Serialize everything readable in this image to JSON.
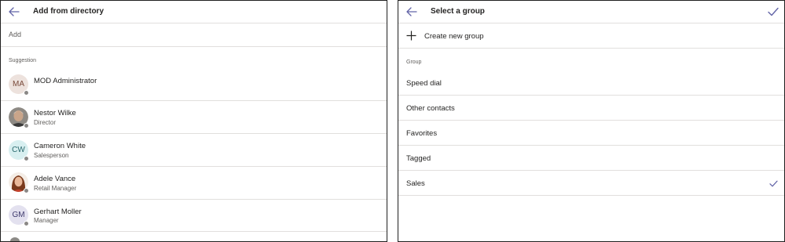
{
  "left": {
    "title": "Add from directory",
    "add_label": "Add",
    "section_label": "Suggestion",
    "people": [
      {
        "initials": "MA",
        "name": "MOD Administrator",
        "title": "",
        "avatar_bg": "#ede2dd",
        "avatar_fg": "#7a4a3a"
      },
      {
        "initials": "",
        "name": "Nestor Wilke",
        "title": "Director",
        "photo": "man"
      },
      {
        "initials": "CW",
        "name": "Cameron White",
        "title": "Salesperson",
        "avatar_bg": "#d8eff0",
        "avatar_fg": "#2b6a6e"
      },
      {
        "initials": "",
        "name": "Adele Vance",
        "title": "Retail Manager",
        "photo": "woman"
      },
      {
        "initials": "GM",
        "name": "Gerhart Moller",
        "title": "Manager",
        "avatar_bg": "#e3e1ef",
        "avatar_fg": "#3f3a6e"
      }
    ]
  },
  "right": {
    "title": "Select a group",
    "create_label": "Create new group",
    "section_label": "Group",
    "groups": [
      {
        "label": "Speed dial",
        "selected": false
      },
      {
        "label": "Other contacts",
        "selected": false
      },
      {
        "label": "Favorites",
        "selected": false
      },
      {
        "label": "Tagged",
        "selected": false
      },
      {
        "label": "Sales",
        "selected": true
      }
    ]
  },
  "colors": {
    "accent": "#6264a7",
    "divider": "#e1dfdd",
    "presence_offline": "#8a8886"
  }
}
